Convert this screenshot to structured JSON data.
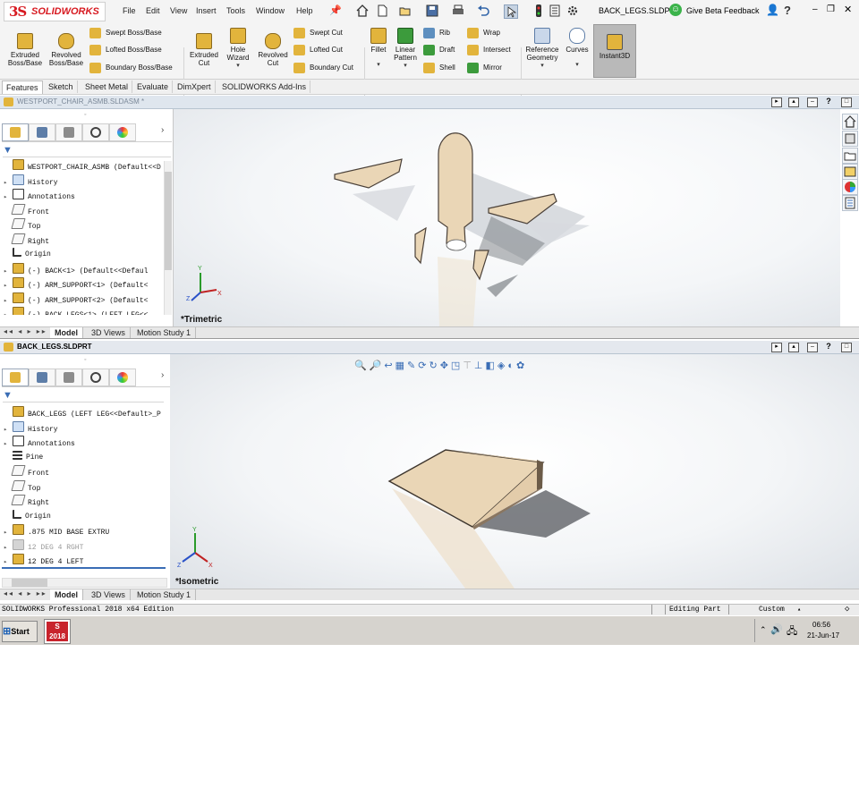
{
  "app": {
    "brand": "SOLIDWORKS",
    "brand_mark": "3S"
  },
  "menu": [
    "File",
    "Edit",
    "View",
    "Insert",
    "Tools",
    "Window",
    "Help"
  ],
  "titlebar": {
    "filename": "BACK_LEGS.SLDPRT",
    "beta_feedback": "Give Beta Feedback",
    "help": "?"
  },
  "ribbon": {
    "extruded_boss": "Extruded\nBoss/Base",
    "revolved_boss": "Revolved\nBoss/Base",
    "swept_boss": "Swept Boss/Base",
    "lofted_boss": "Lofted Boss/Base",
    "boundary_boss": "Boundary Boss/Base",
    "extruded_cut": "Extruded\nCut",
    "hole_wizard": "Hole\nWizard",
    "revolved_cut": "Revolved\nCut",
    "swept_cut": "Swept Cut",
    "lofted_cut": "Lofted Cut",
    "boundary_cut": "Boundary Cut",
    "fillet": "Fillet",
    "linear_pattern": "Linear\nPattern",
    "rib": "Rib",
    "draft": "Draft",
    "shell": "Shell",
    "wrap": "Wrap",
    "intersect": "Intersect",
    "mirror": "Mirror",
    "reference_geometry": "Reference\nGeometry",
    "curves": "Curves",
    "instant3d": "Instant3D"
  },
  "command_tabs": [
    "Features",
    "Sketch",
    "Sheet Metal",
    "Evaluate",
    "DimXpert",
    "SOLIDWORKS Add-Ins"
  ],
  "assembly_window": {
    "title": "WESTPORT_CHAIR_ASMB.SLDASM *",
    "view_label": "*Trimetric",
    "tree": [
      {
        "label": "WESTPORT_CHAIR_ASMB  (Default<<D",
        "arrow": "",
        "icon": "asm"
      },
      {
        "label": "History",
        "arrow": "▸",
        "icon": "hist"
      },
      {
        "label": "Annotations",
        "arrow": "▸",
        "icon": "ann"
      },
      {
        "label": "Front",
        "arrow": "",
        "icon": "plane"
      },
      {
        "label": "Top",
        "arrow": "",
        "icon": "plane"
      },
      {
        "label": "Right",
        "arrow": "",
        "icon": "plane"
      },
      {
        "label": "Origin",
        "arrow": "",
        "icon": "origin"
      },
      {
        "label": "(-) BACK<1> (Default<<Defaul",
        "arrow": "▸",
        "icon": "part"
      },
      {
        "label": "(-) ARM_SUPPORT<1> (Default<",
        "arrow": "▸",
        "icon": "part"
      },
      {
        "label": "(-) ARM_SUPPORT<2> (Default<",
        "arrow": "▸",
        "icon": "part"
      },
      {
        "label": "(-) BACK_LEGS<1> (LEFT LEG<<",
        "arrow": "▸",
        "icon": "part"
      }
    ],
    "bottom_tabs": [
      "Model",
      "3D Views",
      "Motion Study 1"
    ]
  },
  "part_window": {
    "title": "BACK_LEGS.SLDPRT",
    "view_label": "*Isometric",
    "tree": [
      {
        "label": "BACK_LEGS  (LEFT LEG<<Default>_P",
        "arrow": "",
        "icon": "part"
      },
      {
        "label": "History",
        "arrow": "▸",
        "icon": "hist"
      },
      {
        "label": "Annotations",
        "arrow": "▸",
        "icon": "ann"
      },
      {
        "label": "Pine",
        "arrow": "",
        "icon": "mat"
      },
      {
        "label": "Front",
        "arrow": "",
        "icon": "plane"
      },
      {
        "label": "Top",
        "arrow": "",
        "icon": "plane"
      },
      {
        "label": "Right",
        "arrow": "",
        "icon": "plane"
      },
      {
        "label": "Origin",
        "arrow": "",
        "icon": "origin"
      },
      {
        "label": ".875 MID BASE EXTRU",
        "arrow": "▸",
        "icon": "feat"
      },
      {
        "label": "12 DEG 4 RGHT",
        "arrow": "▸",
        "icon": "featgray"
      },
      {
        "label": "12 DEG 4 LEFT",
        "arrow": "▸",
        "icon": "feat"
      }
    ],
    "bottom_tabs": [
      "Model",
      "3D Views",
      "Motion Study 1"
    ]
  },
  "statusbar": {
    "edition": "SOLIDWORKS Professional 2018 x64 Edition",
    "mode": "Editing Part",
    "units": "Custom"
  },
  "taskbar": {
    "start": "Start",
    "sw_badge": "2018",
    "time": "06:56",
    "date": "21-Jun-17"
  },
  "axis_labels": {
    "x": "X",
    "y": "Y",
    "z": "Z"
  },
  "colors": {
    "wood": "#ead6b6",
    "accent_red": "#d71920",
    "doc_bar": "#dfe6ee"
  }
}
